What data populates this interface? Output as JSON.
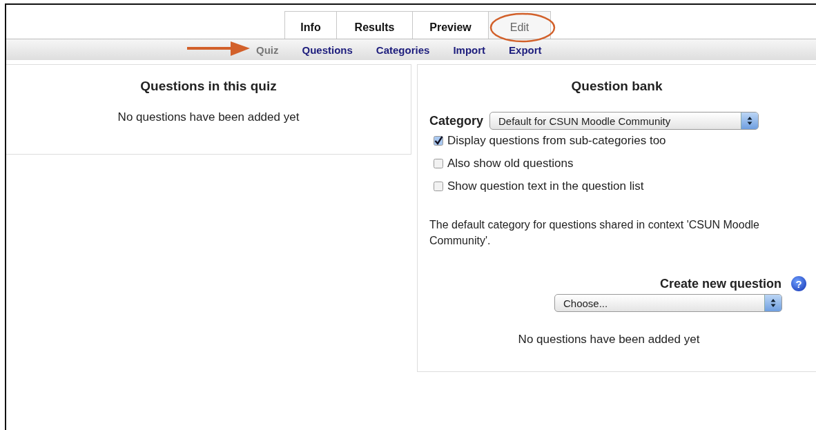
{
  "tabs": [
    {
      "label": "Info",
      "selected": false
    },
    {
      "label": "Results",
      "selected": false
    },
    {
      "label": "Preview",
      "selected": false
    },
    {
      "label": "Edit",
      "selected": true
    }
  ],
  "subtabs": [
    {
      "label": "Quiz",
      "selected": true
    },
    {
      "label": "Questions",
      "selected": false
    },
    {
      "label": "Categories",
      "selected": false
    },
    {
      "label": "Import",
      "selected": false
    },
    {
      "label": "Export",
      "selected": false
    }
  ],
  "quiz_panel": {
    "title": "Questions in this quiz",
    "message": "No questions have been added yet"
  },
  "question_bank": {
    "title": "Question bank",
    "category_label": "Category",
    "category_value": "Default for CSUN Moodle Community",
    "options": [
      {
        "label": "Display questions from sub-categories too",
        "checked": true
      },
      {
        "label": "Also show old questions",
        "checked": false
      },
      {
        "label": "Show question text in the question list",
        "checked": false
      }
    ],
    "description": "The default category for questions shared in context 'CSUN Moodle Community'.",
    "create_label": "Create new question",
    "help_icon": "?",
    "create_value": "Choose...",
    "message": "No questions have been added yet"
  }
}
